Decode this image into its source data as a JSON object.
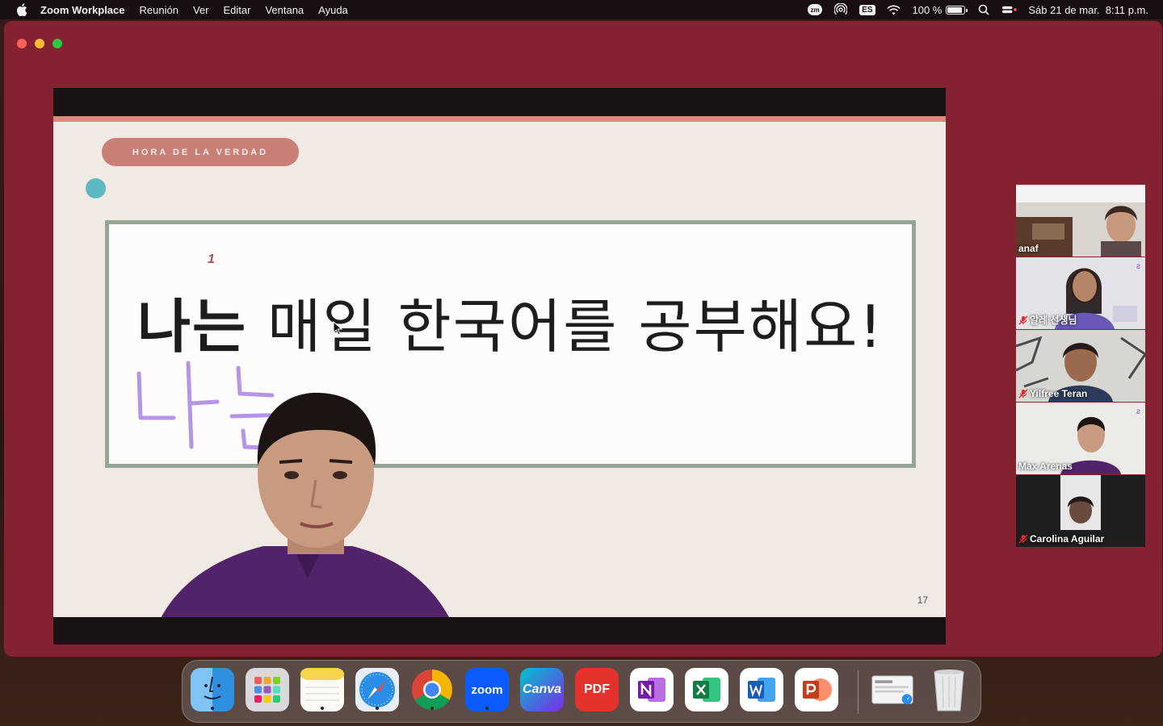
{
  "menubar": {
    "app_name": "Zoom Workplace",
    "menus": [
      "Reunión",
      "Ver",
      "Editar",
      "Ventana",
      "Ayuda"
    ],
    "zoom_indicator": "zm",
    "input_source": "ES",
    "battery_percent": "100 %",
    "battery_level": 1.0,
    "datetime": "Sáb 21 de mar.  8:11 p.m."
  },
  "slide": {
    "tag": "HORA DE LA VERDAD",
    "mark": "1",
    "sentence_bold": "나는",
    "sentence_rest": " 매일 한국어를 공부해요!",
    "handwriting": "나는",
    "page_number": "17"
  },
  "gallery": {
    "participants": [
      {
        "name": "anaf",
        "muted": false,
        "active": false
      },
      {
        "name": "알레 선생님",
        "muted": true,
        "active": false
      },
      {
        "name": "Yilfree Teran",
        "muted": true,
        "active": false
      },
      {
        "name": "Max Arenas",
        "muted": false,
        "active": true
      },
      {
        "name": "Carolina Aguilar",
        "muted": true,
        "active": false
      }
    ]
  },
  "dock": {
    "apps": [
      "Finder",
      "Launchpad",
      "Notes",
      "Safari",
      "Google Chrome",
      "Zoom",
      "Canva",
      "PDF",
      "OneNote",
      "Excel",
      "Word",
      "PowerPoint",
      "Preview",
      "Trash"
    ],
    "zoom_label": "zoom",
    "canva_label": "Canva",
    "pdf_label": "PDF"
  },
  "colors": {
    "window": "#842232",
    "slide_bg": "#f0e9e4",
    "pill": "#c97f76",
    "teal_dot": "#5eb8c4",
    "frame_border": "#95a596",
    "handwriting": "#b495e8",
    "active_speaker": "#3fd66b"
  }
}
